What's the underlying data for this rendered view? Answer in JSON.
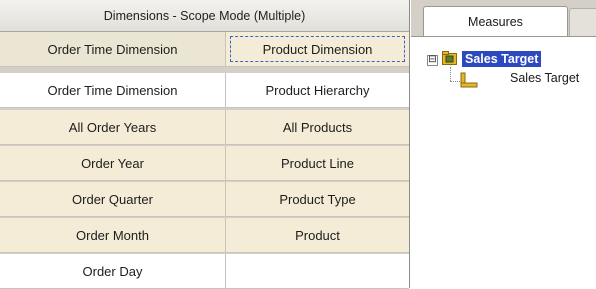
{
  "grid": {
    "title": "Dimensions - Scope Mode (Multiple)",
    "rows": [
      [
        "Order Time Dimension",
        "Product Dimension"
      ],
      [
        "Order Time Dimension",
        "Product Hierarchy"
      ],
      [
        "All Order Years",
        "All Products"
      ],
      [
        "Order Year",
        "Product Line"
      ],
      [
        "Order Quarter",
        "Product Type"
      ],
      [
        "Order Month",
        "Product"
      ],
      [
        "Order Day",
        ""
      ]
    ]
  },
  "right_pane": {
    "tabs": [
      {
        "label": "Measures"
      },
      {
        "label": ""
      }
    ],
    "tree": {
      "expander": "⊟",
      "root": {
        "label": "Sales Target",
        "icon": "cube-folder-icon"
      },
      "child": {
        "label": "Sales Target",
        "icon": "measure-icon"
      }
    }
  },
  "colors": {
    "selection": "#2d49c0",
    "beige_cell": "#f4ecd6",
    "header_row": "#ebe6d4"
  }
}
